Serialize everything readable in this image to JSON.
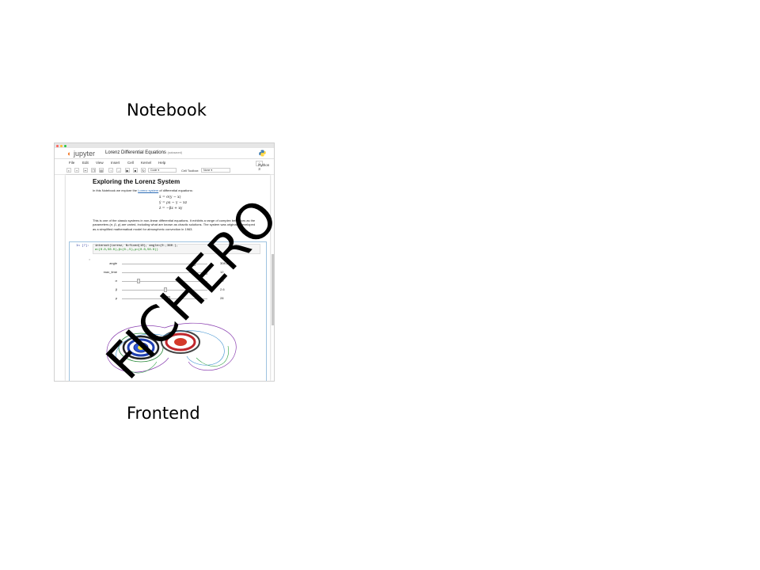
{
  "slide": {
    "top_label": "Notebook",
    "bottom_label": "Frontend",
    "watermark": "FICHERO"
  },
  "notebook": {
    "logo_text": "jupyter",
    "title": "Lorenz Differential Equations",
    "title_status": "(autosaved)",
    "menu": [
      "File",
      "Edit",
      "View",
      "Insert",
      "Cell",
      "Kernel",
      "Help"
    ],
    "kernel": "Python 3",
    "toolbar": {
      "cell_type": "Code",
      "cell_toolbar_label": "Cell Toolbar:",
      "cell_toolbar_value": "None"
    },
    "heading": "Exploring the Lorenz System",
    "intro": {
      "before": "In this Notebook we explore the ",
      "link": "Lorenz system",
      "after": " of differential equations:"
    },
    "equations": [
      "ẋ = σ(y − x)",
      "ẏ = ρx − y − xz",
      "ż = −βz + xy"
    ],
    "paragraph": "This is one of the classic systems in non-linear differential equations. It exhibits a range of complex behaviors as the parameters (σ, β, ρ) are varied, including what are known as chaotic solutions. The system was originally developed as a simplified mathematical model for atmospheric convection in 1963.",
    "cell": {
      "prompt": "In [7]:",
      "code_line1": "interact(Lorenz, N=fixed(10), angle=(0.,360.),",
      "code_line2": "         σ=(0.0,50.0),β=(0.,5),ρ=(0.0,50.0))"
    },
    "sliders": [
      {
        "label": "angle",
        "value": "308.2",
        "fraction": 0.86
      },
      {
        "label": "max_time",
        "value": "12",
        "fraction": 1.0
      },
      {
        "label": "σ",
        "value": "10",
        "fraction": 0.2
      },
      {
        "label": "β",
        "value": "2.6",
        "fraction": 0.52
      },
      {
        "label": "ρ",
        "value": "28",
        "fraction": 0.56
      }
    ]
  }
}
